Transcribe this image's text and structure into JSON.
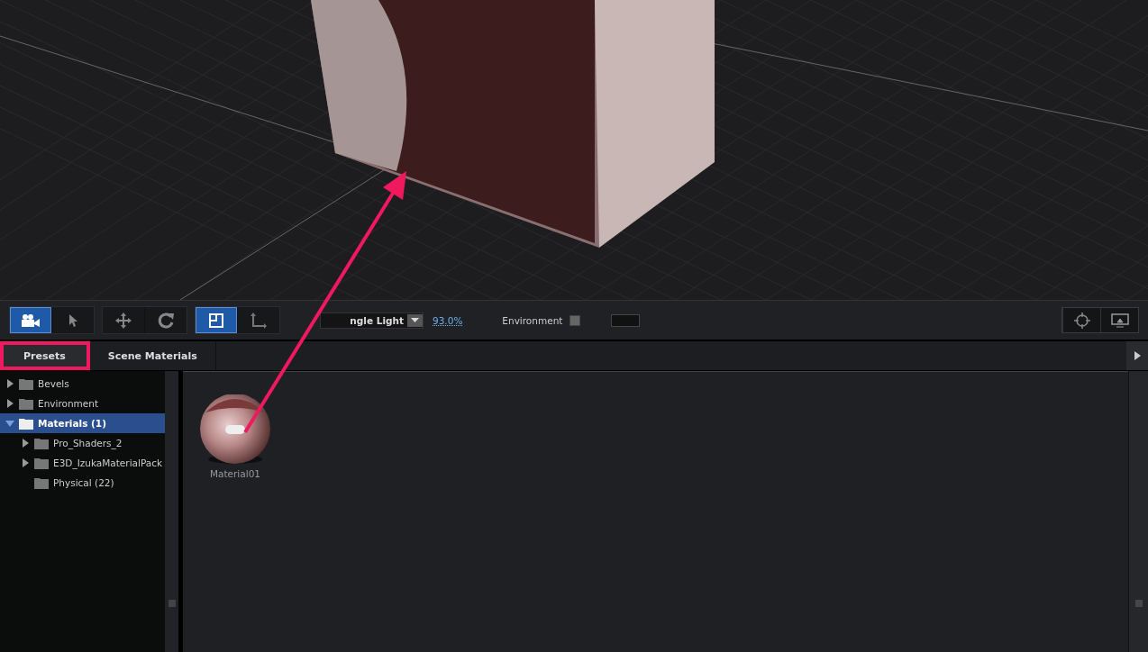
{
  "toolbar": {
    "tools": [
      {
        "kind": "camera",
        "selected": true
      },
      {
        "kind": "pointer",
        "selected": false
      },
      {
        "kind": "move",
        "selected": false
      },
      {
        "kind": "rotate",
        "selected": false
      },
      {
        "kind": "frame",
        "selected": true
      },
      {
        "kind": "axis",
        "selected": false
      }
    ],
    "light_dropdown": {
      "value": "ngle Light"
    },
    "light_level": "93.0%",
    "environment": {
      "label": "Environment",
      "checked": false
    },
    "right_tools": [
      {
        "kind": "target"
      },
      {
        "kind": "monitor"
      }
    ]
  },
  "tabs": [
    {
      "label": "Presets",
      "selected": true
    },
    {
      "label": "Scene Materials",
      "selected": false
    }
  ],
  "tree": [
    {
      "label": "Bevels",
      "expanded": false,
      "selected": false
    },
    {
      "label": "Environment",
      "expanded": false,
      "selected": false
    },
    {
      "label": "Materials (1)",
      "expanded": true,
      "selected": true,
      "children": [
        {
          "label": "Pro_Shaders_2",
          "expanded": false,
          "selected": false,
          "has_children": true
        },
        {
          "label": "E3D_IzukaMaterialPack",
          "expanded": false,
          "selected": false,
          "has_children": true
        },
        {
          "label": "Physical (22)",
          "selected": false,
          "has_children": false
        }
      ]
    }
  ],
  "materials": [
    {
      "name": "Material01"
    }
  ]
}
